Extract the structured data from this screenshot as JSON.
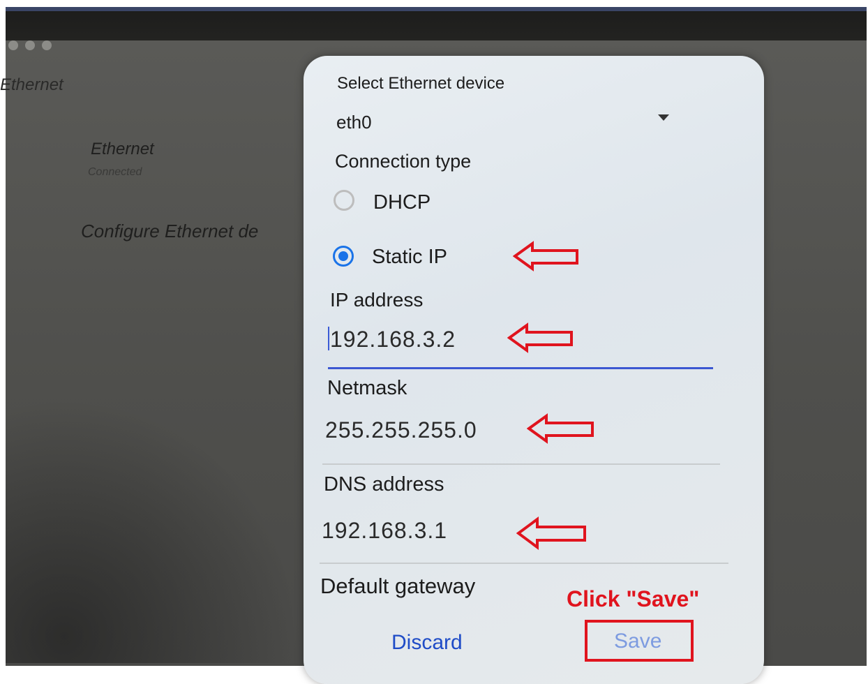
{
  "background": {
    "title": "Ethernet",
    "ethernet_item": "Ethernet",
    "ethernet_status": "Connected",
    "configure_item": "Configure Ethernet de"
  },
  "dialog": {
    "device_label": "Select Ethernet device",
    "device_value": "eth0",
    "connection_type_label": "Connection type",
    "options": [
      {
        "label": "DHCP",
        "selected": false
      },
      {
        "label": "Static IP",
        "selected": true
      }
    ],
    "ip_label": "IP address",
    "ip_value": "192.168.3.2",
    "netmask_label": "Netmask",
    "netmask_value": "255.255.255.0",
    "dns_label": "DNS address",
    "dns_value": "192.168.3.1",
    "gateway_label": "Default gateway",
    "discard_label": "Discard",
    "save_label": "Save"
  },
  "annotation": {
    "text": "Click \"Save\"",
    "color": "#e0141e"
  },
  "colors": {
    "accent": "#1a73e8",
    "button_text": "#1f4cc7"
  }
}
